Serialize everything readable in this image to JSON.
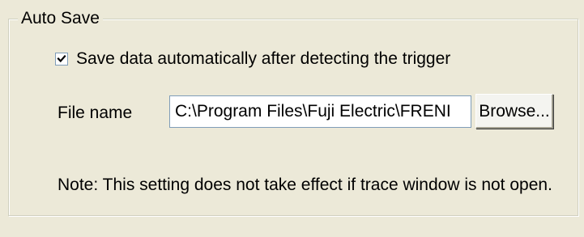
{
  "auto_save": {
    "group_title": "Auto Save",
    "checkbox_label": "Save data automatically after detecting the trigger",
    "checkbox_checked": true,
    "file_name_label": "File name",
    "file_name_value": "C:\\Program Files\\Fuji Electric\\FRENI",
    "browse_label": "Browse...",
    "note": "Note: This setting does not take effect if trace window is not open."
  },
  "colors": {
    "background": "#ece9d8",
    "field_border": "#7f9db9",
    "text": "#000000"
  },
  "icons": {
    "checkbox": "checkmark-icon"
  }
}
